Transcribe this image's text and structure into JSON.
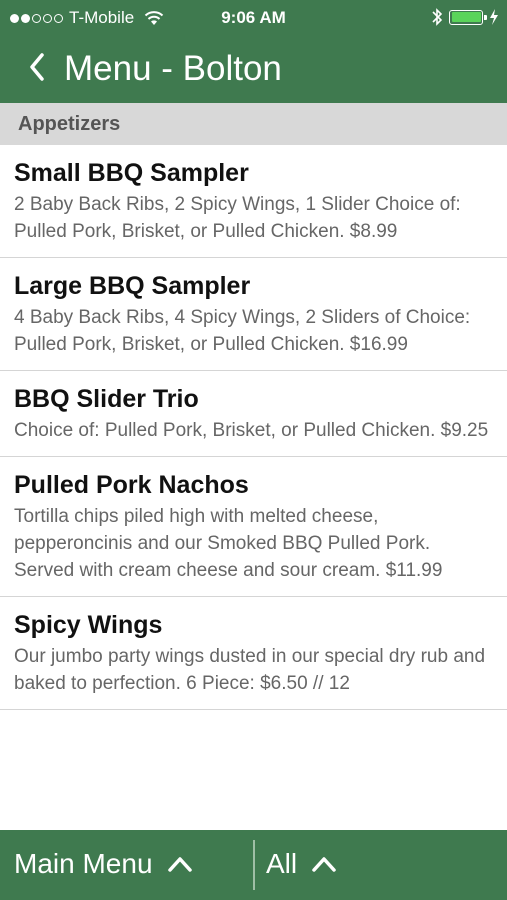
{
  "status": {
    "carrier": "T-Mobile",
    "time": "9:06 AM"
  },
  "nav": {
    "back_glyph": "<",
    "title": "Menu - Bolton"
  },
  "section": {
    "title": "Appetizers"
  },
  "items": [
    {
      "title": "Small BBQ Sampler",
      "desc": "2 Baby Back Ribs, 2 Spicy Wings, 1 Slider Choice of: Pulled Pork, Brisket, or Pulled Chicken. $8.99"
    },
    {
      "title": "Large BBQ Sampler",
      "desc": "4 Baby Back Ribs, 4 Spicy Wings, 2 Sliders of Choice: Pulled Pork, Brisket, or Pulled Chicken. $16.99"
    },
    {
      "title": "BBQ Slider Trio",
      "desc": "Choice of: Pulled Pork, Brisket, or Pulled Chicken. $9.25"
    },
    {
      "title": "Pulled Pork Nachos",
      "desc": "Tortilla chips piled high with melted cheese, pepperoncinis and our Smoked BBQ Pulled Pork. Served with cream cheese and sour cream. $11.99"
    },
    {
      "title": "Spicy Wings",
      "desc": "Our jumbo party wings dusted in our special dry rub and baked to perfection. 6 Piece: $6.50 // 12"
    }
  ],
  "tabbar": {
    "main_label": "Main Menu",
    "all_label": "All"
  },
  "colors": {
    "header_green": "#3f7a4f",
    "section_gray": "#d8d8d8"
  }
}
